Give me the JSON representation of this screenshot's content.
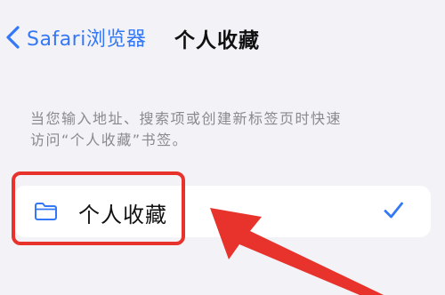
{
  "nav": {
    "back_label": "Safari浏览器",
    "title": "个人收藏"
  },
  "footer_text": {
    "line1": "当您输入地址、搜索项或创建新标签页时快速",
    "line2": "访问“个人收藏”书签。"
  },
  "list": {
    "items": [
      {
        "label": "个人收藏",
        "icon": "folder-icon",
        "selected": true
      }
    ]
  },
  "annotation": {
    "highlight_color": "#e8332c",
    "arrow_color": "#e8332c"
  },
  "colors": {
    "accent": "#3478f6",
    "background": "#f2f2f7",
    "secondary_text": "#8a8a8e"
  }
}
